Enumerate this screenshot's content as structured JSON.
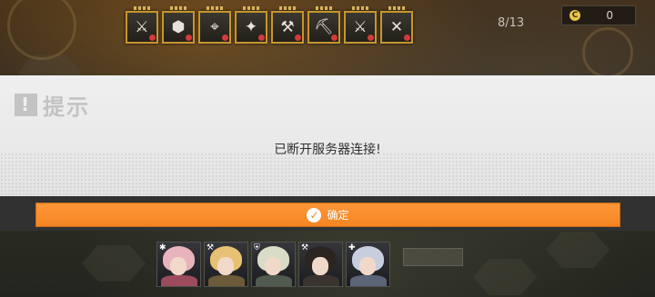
{
  "topbar": {
    "relics": [
      {
        "icon": "blade-icon",
        "glyph": "⚔"
      },
      {
        "icon": "hexagon-icon",
        "glyph": "⬢"
      },
      {
        "icon": "crosshair-icon",
        "glyph": "⌖"
      },
      {
        "icon": "sparkle-icon",
        "glyph": "✦"
      },
      {
        "icon": "hammer-icon",
        "glyph": "⚒"
      },
      {
        "icon": "pickaxe-icon",
        "glyph": "⛏"
      },
      {
        "icon": "crossed-swords-icon",
        "glyph": "⚔"
      },
      {
        "icon": "crossed-tools-icon",
        "glyph": "✕"
      }
    ],
    "progress": "8/13",
    "coin_symbol": "C",
    "coin_count": "0"
  },
  "dialog": {
    "icon_glyph": "!",
    "title": "提示",
    "message": "已断开服务器连接!",
    "confirm_check": "✓",
    "confirm_label": "确定"
  },
  "team": [
    {
      "class_icon": "✱",
      "hair": "#e8b3bd",
      "body": "#9c4b5c"
    },
    {
      "class_icon": "⚒",
      "hair": "#e7c173",
      "body": "#6d5a38"
    },
    {
      "class_icon": "⛨",
      "hair": "#d9dcc7",
      "body": "#515a4f"
    },
    {
      "class_icon": "⚒",
      "hair": "#2b2522",
      "body": "#3a3430"
    },
    {
      "class_icon": "✚",
      "hair": "#c7cede",
      "body": "#5c6478"
    }
  ],
  "colors": {
    "accent_orange": "#f48522",
    "dialog_bg": "#efefef",
    "relic_border": "#c6962e"
  }
}
